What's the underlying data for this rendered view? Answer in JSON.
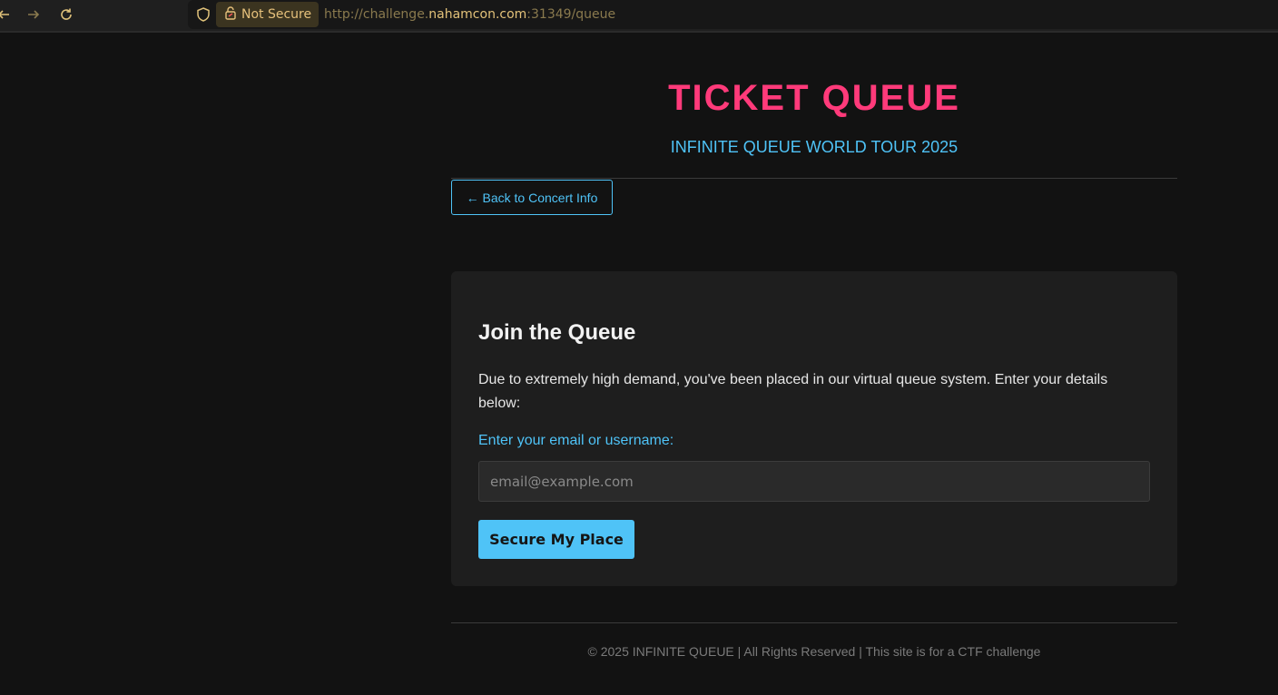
{
  "browser": {
    "security_label": "Not Secure",
    "url_prefix": "http://challenge.",
    "url_host": "nahamcon.com",
    "url_suffix": ":31349/queue",
    "accent_color": "#e5c07b"
  },
  "header": {
    "title": "TICKET QUEUE",
    "subtitle": "INFINITE QUEUE WORLD TOUR 2025",
    "back_button": "← Back to Concert Info"
  },
  "card": {
    "title": "Join the Queue",
    "description": "Due to extremely high demand, you've been placed in our virtual queue system. Enter your details below:",
    "field_label": "Enter your email or username:",
    "input_placeholder": "email@example.com",
    "input_value": "",
    "submit_label": "Secure My Place"
  },
  "footer": {
    "text": "© 2025 INFINITE QUEUE | All Rights Reserved | This site is for a CTF challenge"
  },
  "colors": {
    "title_pink": "#ff3a7a",
    "accent_blue": "#4fc3f7",
    "background": "#121212",
    "card": "#1e1e1e"
  }
}
